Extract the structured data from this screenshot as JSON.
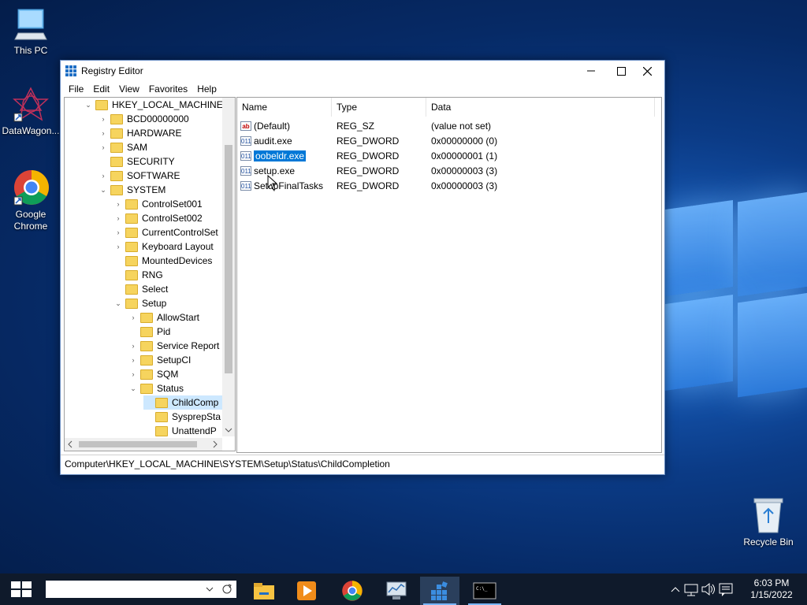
{
  "desktop": {
    "icons": [
      {
        "label": "This PC"
      },
      {
        "label": "DataWagon..."
      },
      {
        "label": "Google Chrome"
      },
      {
        "label": "Recycle Bin"
      }
    ]
  },
  "window": {
    "title": "Registry Editor",
    "menu": [
      "File",
      "Edit",
      "View",
      "Favorites",
      "Help"
    ]
  },
  "tree": {
    "nodes": [
      {
        "label": "HKEY_LOCAL_MACHINE",
        "chev": "⌄"
      },
      {
        "label": "BCD00000000",
        "chev": "›"
      },
      {
        "label": "HARDWARE",
        "chev": "›"
      },
      {
        "label": "SAM",
        "chev": "›"
      },
      {
        "label": "SECURITY",
        "chev": ""
      },
      {
        "label": "SOFTWARE",
        "chev": "›"
      },
      {
        "label": "SYSTEM",
        "chev": "⌄"
      },
      {
        "label": "ControlSet001",
        "chev": "›"
      },
      {
        "label": "ControlSet002",
        "chev": "›"
      },
      {
        "label": "CurrentControlSet",
        "chev": "›"
      },
      {
        "label": "Keyboard Layout",
        "chev": "›"
      },
      {
        "label": "MountedDevices",
        "chev": ""
      },
      {
        "label": "RNG",
        "chev": ""
      },
      {
        "label": "Select",
        "chev": ""
      },
      {
        "label": "Setup",
        "chev": "⌄"
      },
      {
        "label": "AllowStart",
        "chev": "›"
      },
      {
        "label": "Pid",
        "chev": ""
      },
      {
        "label": "Service Report",
        "chev": "›"
      },
      {
        "label": "SetupCI",
        "chev": "›"
      },
      {
        "label": "SQM",
        "chev": "›"
      },
      {
        "label": "Status",
        "chev": "⌄"
      },
      {
        "label": "ChildComp",
        "chev": ""
      },
      {
        "label": "SysprepSta",
        "chev": ""
      },
      {
        "label": "UnattendP",
        "chev": ""
      }
    ]
  },
  "list": {
    "columns": [
      "Name",
      "Type",
      "Data"
    ],
    "rows": [
      {
        "name": "(Default)",
        "type": "REG_SZ",
        "data": "(value not set)",
        "icon": "ab"
      },
      {
        "name": "audit.exe",
        "type": "REG_DWORD",
        "data": "0x00000000 (0)",
        "icon": "011"
      },
      {
        "name": "oobeldr.exe",
        "type": "REG_DWORD",
        "data": "0x00000001 (1)",
        "icon": "011"
      },
      {
        "name": "setup.exe",
        "type": "REG_DWORD",
        "data": "0x00000003 (3)",
        "icon": "011"
      },
      {
        "name": "SetupFinalTasks",
        "type": "REG_DWORD",
        "data": "0x00000003 (3)",
        "icon": "011"
      }
    ]
  },
  "status": {
    "path": "Computer\\HKEY_LOCAL_MACHINE\\SYSTEM\\Setup\\Status\\ChildCompletion"
  },
  "taskbar": {
    "time": "6:03 PM",
    "date": "1/15/2022"
  }
}
